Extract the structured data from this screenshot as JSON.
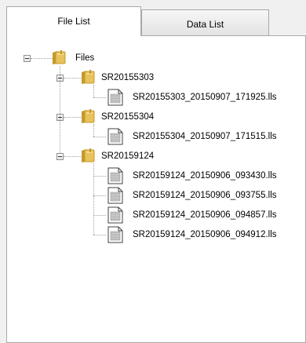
{
  "tabs": [
    {
      "label": "File List"
    },
    {
      "label": "Data List"
    }
  ],
  "tree": {
    "root": {
      "label": "Files",
      "icon": "folder-icon"
    },
    "groups": [
      {
        "label": "SR20155303",
        "icon": "folder-icon",
        "files": [
          {
            "label": "SR20155303_20150907_171925.lls",
            "icon": "file-icon"
          }
        ]
      },
      {
        "label": "SR20155304",
        "icon": "folder-icon",
        "files": [
          {
            "label": "SR20155304_20150907_171515.lls",
            "icon": "file-icon"
          }
        ]
      },
      {
        "label": "SR20159124",
        "icon": "folder-icon",
        "files": [
          {
            "label": "SR20159124_20150906_093430.lls",
            "icon": "file-icon"
          },
          {
            "label": "SR20159124_20150906_093755.lls",
            "icon": "file-icon"
          },
          {
            "label": "SR20159124_20150906_094857.lls",
            "icon": "file-icon"
          },
          {
            "label": "SR20159124_20150906_094912.lls",
            "icon": "file-icon"
          }
        ]
      }
    ]
  },
  "colors": {
    "folder": "#e8c25a",
    "folder_dark": "#c49a2c",
    "border": "#a8a8a8"
  }
}
